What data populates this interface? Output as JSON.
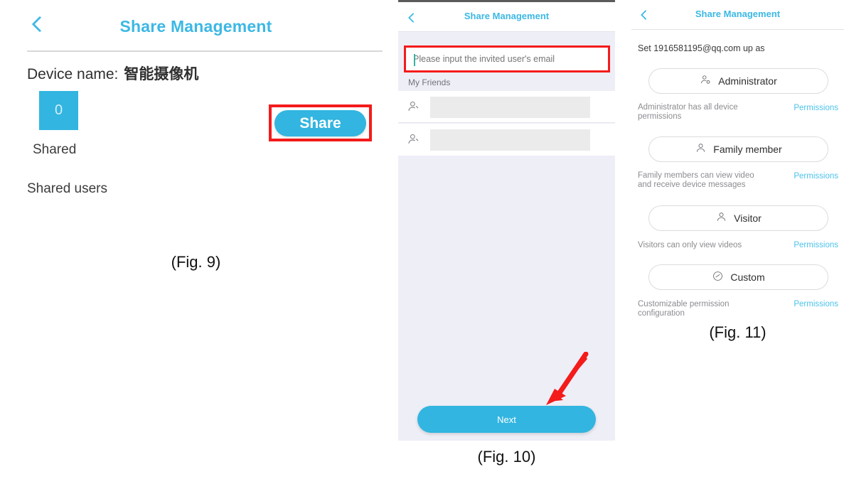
{
  "fig9": {
    "caption": "(Fig. 9)",
    "header": {
      "back_icon": "chevron-left-icon",
      "title": "Share Management"
    },
    "device_label": "Device name:",
    "device_name": "智能摄像机",
    "shared_count": "0",
    "shared_label": "Shared",
    "shared_users_label": "Shared users",
    "share_button": "Share",
    "highlight_color": "#f41b1b",
    "accent_color": "#32b5e0"
  },
  "fig10": {
    "caption": "(Fig. 10)",
    "header": {
      "back_icon": "chevron-left-icon",
      "title": "Share Management"
    },
    "email_input": {
      "value": "",
      "placeholder": "Please input the invited user's email"
    },
    "section_header": "My Friends",
    "friends": [
      {
        "avatar_icon": "person-add-icon",
        "name": ""
      },
      {
        "avatar_icon": "person-add-icon",
        "name": ""
      }
    ],
    "next_button": "Next",
    "annotation_arrow": "red-arrow-icon",
    "highlight_color": "#f41b1b",
    "accent_color": "#32b5e0",
    "screen_bg": "#eeeef7"
  },
  "fig11": {
    "caption": "(Fig. 11)",
    "header": {
      "back_icon": "chevron-left-icon",
      "title": "Share Management"
    },
    "set_up_line": "Set 1916581195@qq.com up as",
    "permissions_link": "Permissions",
    "link_color": "#4cc2ea",
    "roles": [
      {
        "label": "Administrator",
        "icon": "person-gear-icon",
        "description": "Administrator has all device permissions",
        "permissions_label": "Permissions"
      },
      {
        "label": "Family member",
        "icon": "person-icon",
        "description": "Family members can view video and receive device messages",
        "permissions_label": "Permissions"
      },
      {
        "label": "Visitor",
        "icon": "person-icon",
        "description": "Visitors can only view videos",
        "permissions_label": "Permissions"
      },
      {
        "label": "Custom",
        "icon": "check-circle-icon",
        "description": "Customizable permission configuration",
        "permissions_label": "Permissions"
      }
    ]
  }
}
